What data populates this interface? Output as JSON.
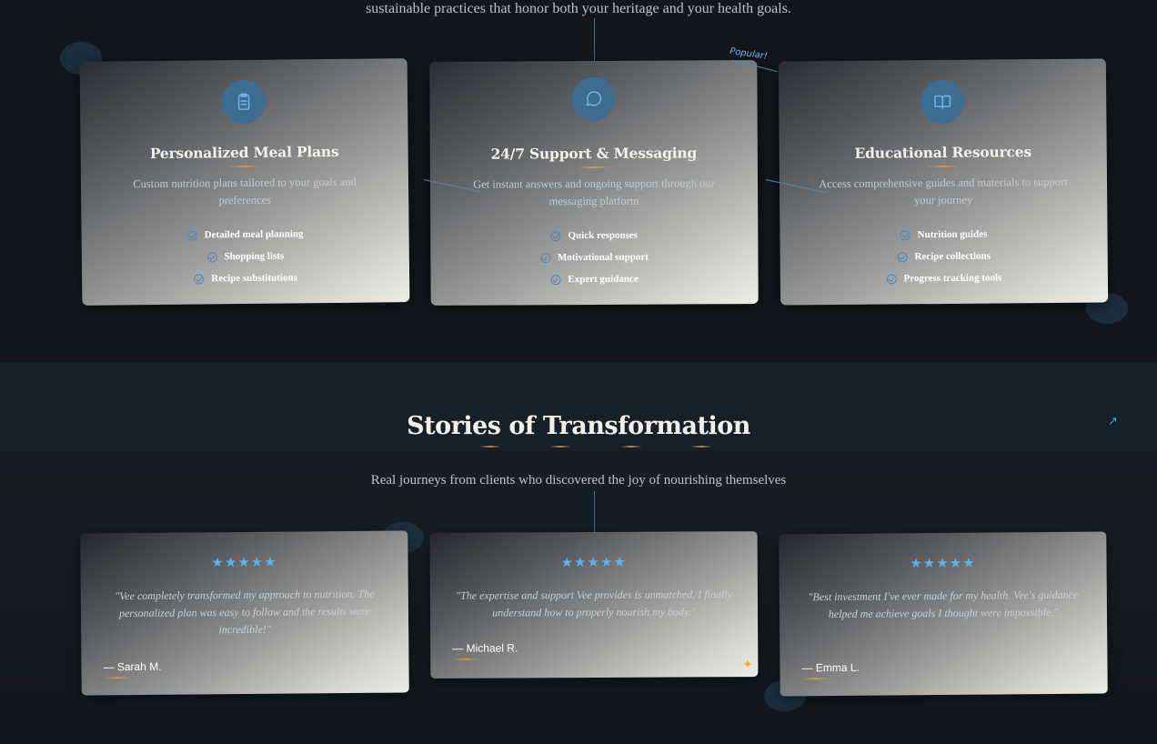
{
  "intro": {
    "text": "sustainable practices that honor both your heritage and your health goals."
  },
  "services": [
    {
      "icon": "clipboard-icon",
      "title": "Personalized Meal Plans",
      "description": "Custom nutrition plans tailored to your goals and preferences",
      "features": [
        "Detailed meal planning",
        "Shopping lists",
        "Recipe substitutions"
      ]
    },
    {
      "icon": "chat-bubble-icon",
      "title": "24/7 Support & Messaging",
      "description": "Get instant answers and ongoing support through our messaging platform",
      "features": [
        "Quick responses",
        "Motivational support",
        "Expert guidance"
      ],
      "badge": "Popular!"
    },
    {
      "icon": "open-book-icon",
      "title": "Educational Resources",
      "description": "Access comprehensive guides and materials to support your journey",
      "features": [
        "Nutrition guides",
        "Recipe collections",
        "Progress tracking tools"
      ]
    }
  ],
  "testimonials_section": {
    "title": "Stories of Transformation",
    "subtitle": "Real journeys from clients who discovered the joy of nourishing themselves",
    "link_icon": "arrow-up-right-icon",
    "link_glyph": "↗"
  },
  "testimonials": [
    {
      "stars": "★★★★★",
      "rating": 5,
      "quote": "\"Vee completely transformed my approach to nutrition. The personalized plan was easy to follow and the results were incredible!\"",
      "author": "— Sarah M."
    },
    {
      "stars": "★★★★★",
      "rating": 5,
      "quote": "\"The expertise and support Vee provides is unmatched. I finally understand how to properly nourish my body.\"",
      "author": "— Michael R."
    },
    {
      "stars": "★★★★★",
      "rating": 5,
      "quote": "\"Best investment I've ever made for my health. Vee's guidance helped me achieve goals I thought were impossible.\"",
      "author": "— Emma L."
    }
  ],
  "colors": {
    "background": "#13171d",
    "accent_blue": "#5fb0e6",
    "accent_gold": "#c49a5d"
  }
}
